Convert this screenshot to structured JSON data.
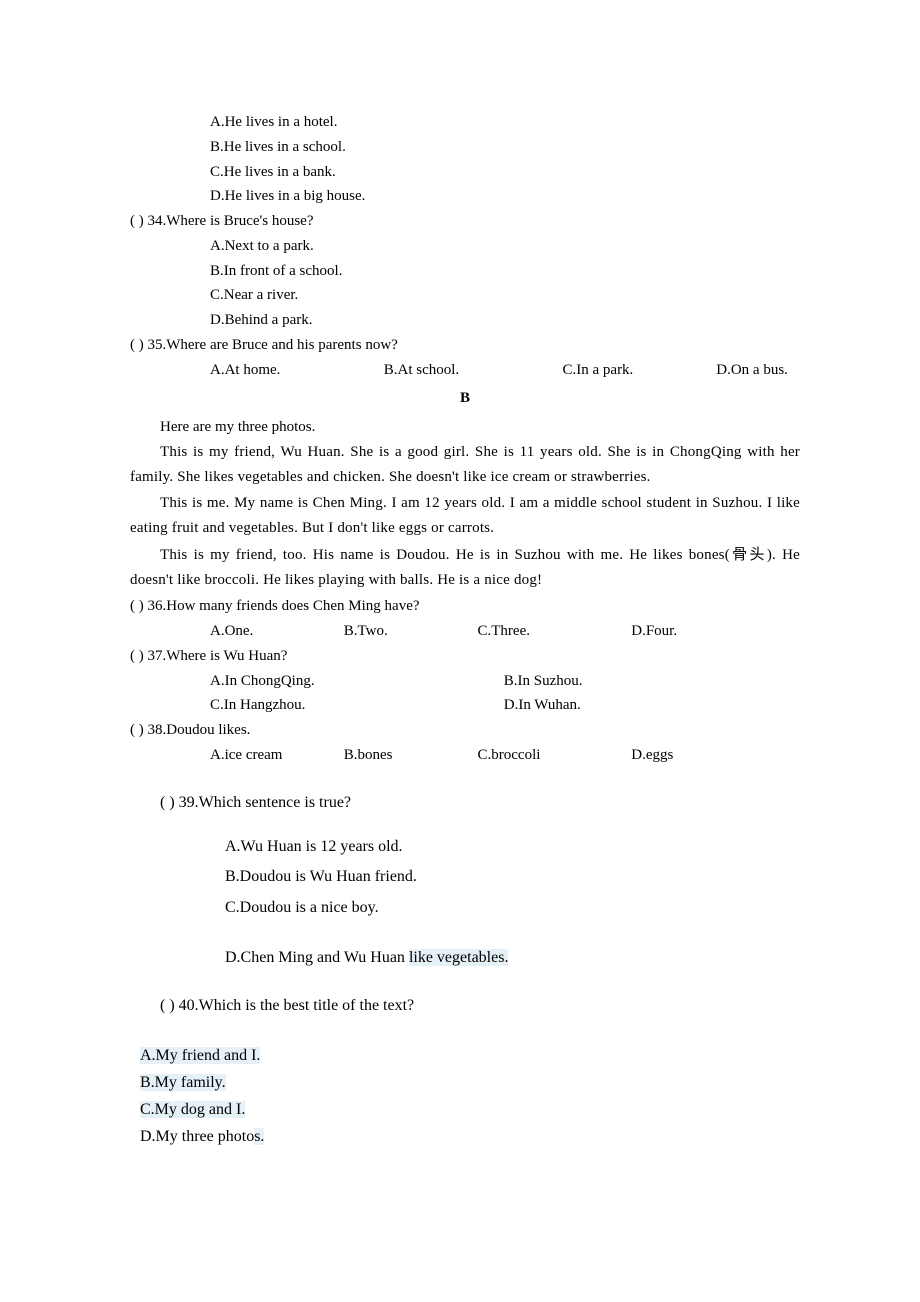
{
  "q33_opts": {
    "a": "A.He lives in a hotel.",
    "b": "B.He lives in a school.",
    "c": "C.He lives in a bank.",
    "d": "D.He lives in a big house."
  },
  "q34": {
    "prefix": "(   ) 34.Where is Bruce's house?",
    "a": "A.Next to a park.",
    "b": "B.In front of a school.",
    "c": "C.Near a river.",
    "d": "D.Behind a park."
  },
  "q35": {
    "prefix": "(   ) 35.Where are Bruce and his parents now?",
    "a": "A.At home.",
    "b": "B.At school.",
    "c": "C.In a park.",
    "d": "D.On a bus."
  },
  "section_b": "B",
  "passage": {
    "p1": "Here are my three photos.",
    "p2": "This is my friend, Wu Huan. She is a good girl. She is 11 years old. She is in ChongQing with her family. She likes vegetables and chicken. She doesn't like ice cream or strawberries.",
    "p3": "This is me. My name is Chen Ming. I am 12 years old. I am a middle school student in Suzhou. I like eating fruit and vegetables. But I don't like eggs or carrots.",
    "p4": "This is my friend, too. His name is Doudou. He is in Suzhou with me. He likes bones(骨头). He doesn't like broccoli. He likes playing with balls. He is a nice dog!"
  },
  "q36": {
    "prefix": "(   ) 36.How many friends does Chen Ming have?",
    "a": "A.One.",
    "b": "B.Two.",
    "c": "C.Three.",
    "d": "D.Four."
  },
  "q37": {
    "prefix": "(   ) 37.Where is Wu Huan?",
    "a": "A.In ChongQing.",
    "b": "B.In Suzhou.",
    "c": "C.In Hangzhou.",
    "d": "D.In Wuhan."
  },
  "q38": {
    "prefix": "(   ) 38.Doudou likes.",
    "a": "A.ice cream",
    "b": "B.bones",
    "c": "C.broccoli",
    "d": "D.eggs"
  },
  "q39": {
    "prefix": "(     ) 39.Which sentence is true?",
    "a": "A.Wu Huan is 12 years old.",
    "b": "B.Doudou is Wu Huan friend.",
    "c": "C.Doudou is a nice boy.",
    "d_pre": "D.Chen Ming and Wu Huan ",
    "d_hl": "like vegetables."
  },
  "q40": {
    "prefix": "(     ) 40.Which is the best title of the text?",
    "a_pre": "A.My friend and ",
    "a_hl": "I.",
    "b_pre": "B.My family.",
    "c_pre": "C.My dog and ",
    "c_hl": "I.",
    "d_pre": "D.My three photo",
    "d_hl": "s."
  }
}
